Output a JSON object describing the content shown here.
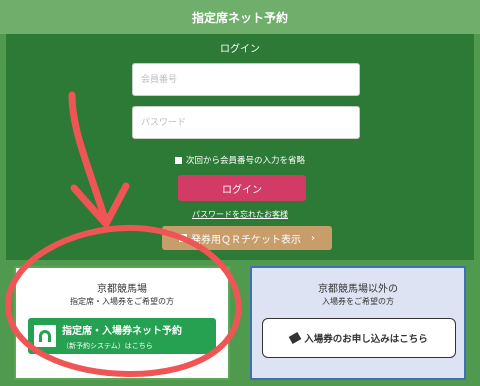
{
  "header": {
    "title": "指定席ネット予約"
  },
  "login": {
    "title": "ログイン",
    "member_placeholder": "会員番号",
    "password_placeholder": "パスワード",
    "remember_label": "次回から会員番号の入力を省略",
    "login_button": "ログイン",
    "forgot_link": "パスワードを忘れたお客様",
    "qr_button": "発券用ＱＲチケット表示",
    "qr_chevron": "›"
  },
  "cards": {
    "kyoto": {
      "title": "京都競馬場",
      "subtitle": "指定席・入場券をご希望の方",
      "button_main": "指定席・入場券ネット予約",
      "button_sub": "（新予約システム）はこちら"
    },
    "other": {
      "title": "京都競馬場以外の",
      "subtitle": "入場券をご希望の方",
      "button": "入場券のお申し込みはこちら"
    }
  },
  "colors": {
    "header": "#6fae6b",
    "panel": "#2d7a36",
    "login_button": "#d23b66",
    "qr_button": "#c79e6a",
    "reserve_button": "#25a151",
    "annotation": "#ef5555"
  }
}
